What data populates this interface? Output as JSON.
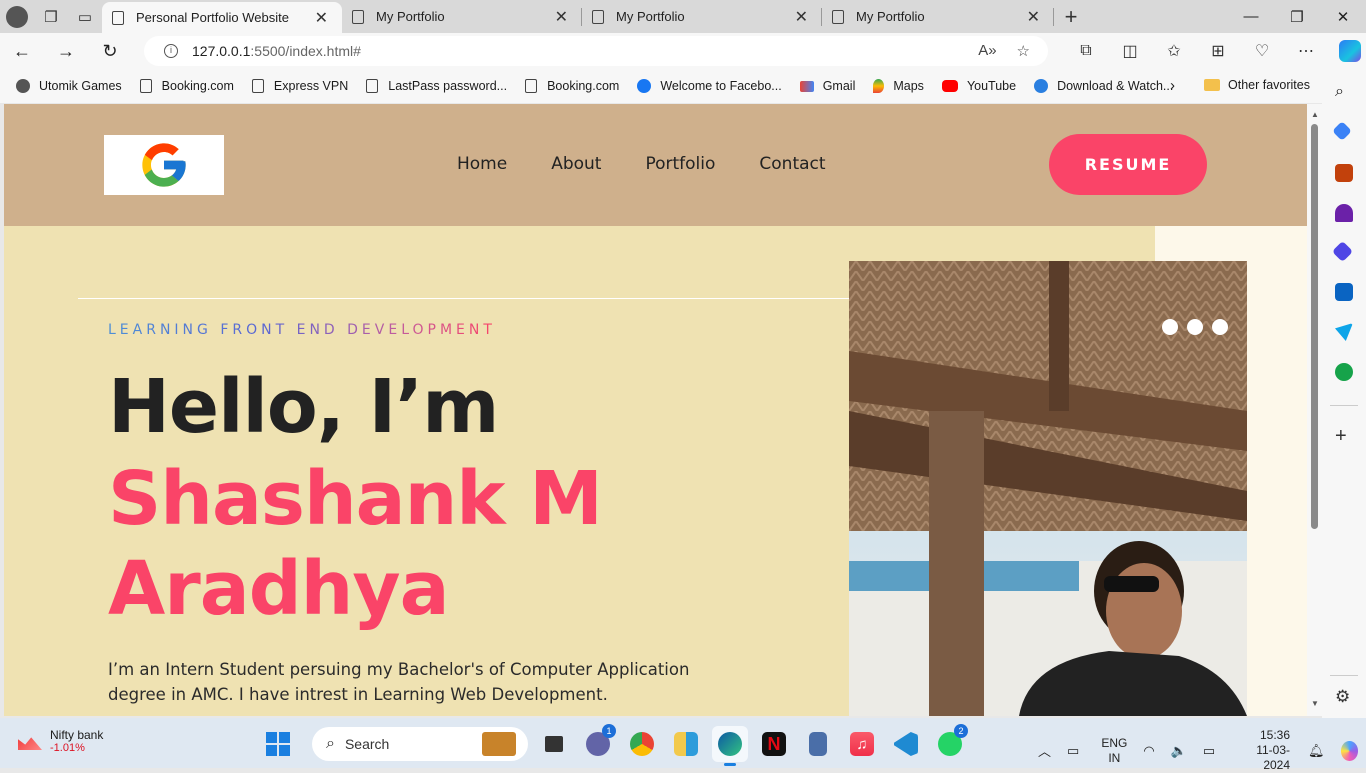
{
  "browser": {
    "tabs": [
      {
        "title": "Personal Portfolio Website",
        "active": true
      },
      {
        "title": "My Portfolio",
        "active": false
      },
      {
        "title": "My Portfolio",
        "active": false
      },
      {
        "title": "My Portfolio",
        "active": false
      }
    ],
    "url_host": "127.0.0.1",
    "url_path": ":5500/index.html#",
    "bookmarks": [
      "Utomik Games",
      "Booking.com",
      "Express VPN",
      "LastPass password...",
      "Booking.com",
      "Welcome to Facebo...",
      "Gmail",
      "Maps",
      "YouTube",
      "Download & Watch..."
    ],
    "other_favorites": "Other favorites"
  },
  "site": {
    "nav": [
      "Home",
      "About",
      "Portfolio",
      "Contact"
    ],
    "resume_label": "RESUME",
    "kicker": "LEARNING FRONT END DEVELOPMENT",
    "hello": "Hello, I’m",
    "name_line1": "Shashank M",
    "name_line2": "Aradhya",
    "description": "I’m an Intern Student persuing my Bachelor's of Computer Application degree in AMC. I have intrest in Learning Web Development.",
    "accent_color": "#fa4468",
    "header_color": "#cfb08c",
    "hero_bg": "#efe2b2"
  },
  "taskbar": {
    "widget_title": "Nifty bank",
    "widget_value": "-1.01%",
    "search_placeholder": "Search",
    "teams_badge": "1",
    "whatsapp_badge": "2",
    "lang_top": "ENG",
    "lang_bottom": "IN",
    "time": "15:36",
    "date": "11-03-2024"
  }
}
